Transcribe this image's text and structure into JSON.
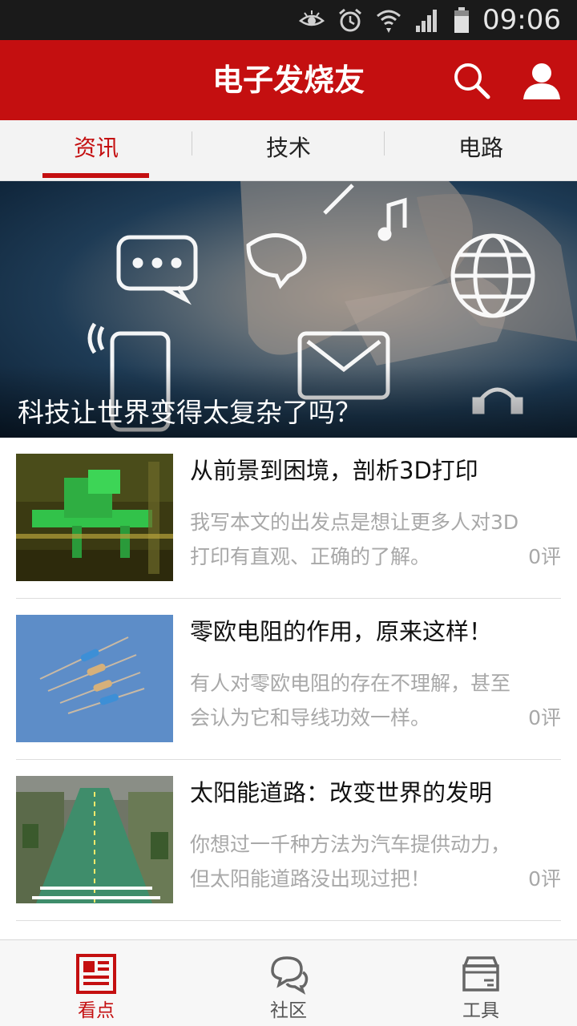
{
  "status_bar": {
    "time": "09:06"
  },
  "header": {
    "title": "电子发烧友"
  },
  "tabs": [
    {
      "label": "资讯",
      "active": true
    },
    {
      "label": "技术",
      "active": false
    },
    {
      "label": "电路",
      "active": false
    }
  ],
  "hero": {
    "caption": "科技让世界变得太复杂了吗？"
  },
  "articles": [
    {
      "title": "从前景到困境，剖析3D打印",
      "summary": "我写本文的出发点是想让更多人对3D打印有直观、正确的了解。",
      "comments": "0评"
    },
    {
      "title": "零欧电阻的作用，原来这样！",
      "summary": "有人对零欧电阻的存在不理解，甚至会认为它和导线功效一样。",
      "comments": "0评"
    },
    {
      "title": "太阳能道路：改变世界的发明",
      "summary": "你想过一千种方法为汽车提供动力，但太阳能道路没出现过把！",
      "comments": "0评"
    }
  ],
  "bottom_nav": [
    {
      "label": "看点",
      "icon": "news-icon",
      "active": true
    },
    {
      "label": "社区",
      "icon": "chat-bubbles-icon",
      "active": false
    },
    {
      "label": "工具",
      "icon": "toolbox-icon",
      "active": false
    }
  ],
  "colors": {
    "brand_red": "#c40f10",
    "status_bar": "#1a1a1a",
    "muted_text": "#a8a8a8"
  }
}
